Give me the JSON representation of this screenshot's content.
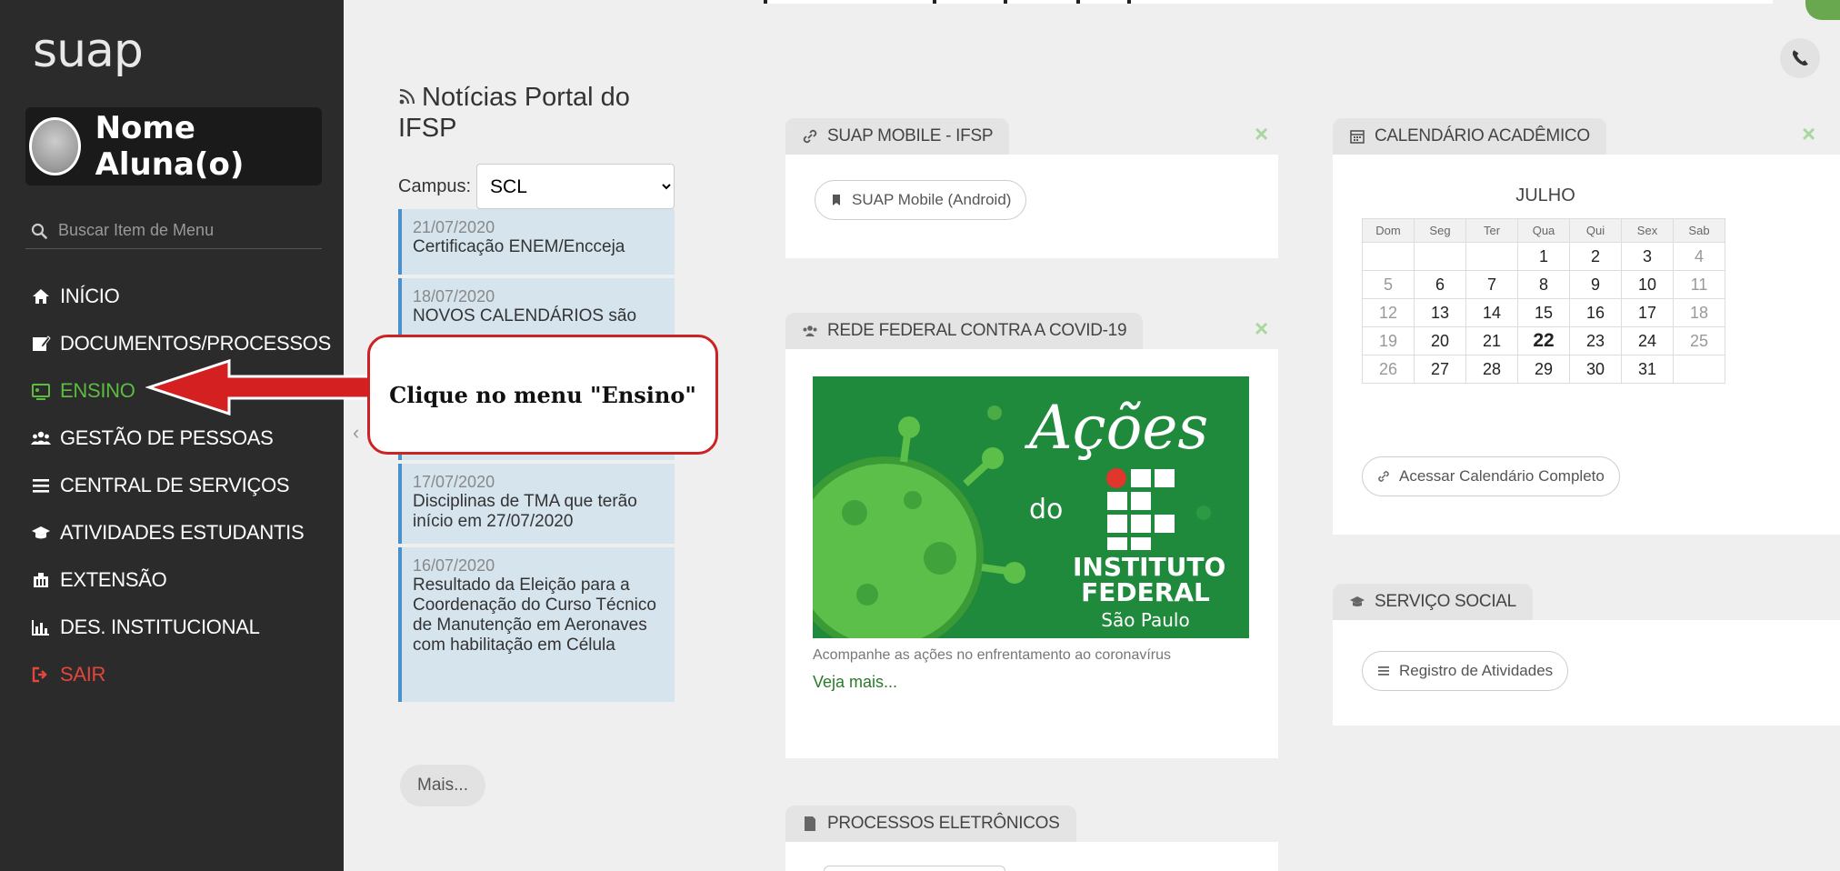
{
  "sidebar": {
    "logo": "suap",
    "user_name": "Nome Aluna(o)",
    "search_placeholder": "Buscar Item de Menu",
    "menu": [
      {
        "label": "INÍCIO",
        "icon": "home-icon"
      },
      {
        "label": "DOCUMENTOS/PROCESSOS",
        "icon": "document-edit-icon"
      },
      {
        "label": "ENSINO",
        "icon": "presentation-board-icon"
      },
      {
        "label": "GESTÃO DE PESSOAS",
        "icon": "users-icon"
      },
      {
        "label": "CENTRAL DE SERVIÇOS",
        "icon": "list-icon"
      },
      {
        "label": "ATIVIDADES ESTUDANTIS",
        "icon": "graduation-cap-icon"
      },
      {
        "label": "EXTENSÃO",
        "icon": "building-icon"
      },
      {
        "label": "DES. INSTITUCIONAL",
        "icon": "bar-chart-icon"
      },
      {
        "label": "SAIR",
        "icon": "sign-out-icon"
      }
    ],
    "active_color": "#5dbb42",
    "logout_color": "#e2463c"
  },
  "news": {
    "title": "Notícias Portal do IFSP",
    "campus_label": "Campus:",
    "campus_value": "SCL",
    "items": [
      {
        "date": "21/07/2020",
        "text": "Certificação ENEM/Encceja"
      },
      {
        "date": "18/07/2020",
        "text": "NOVOS CALENDÁRIOS são"
      },
      {
        "date": "17/07/2020",
        "text": "Disciplinas de TMA que terão início em 27/07/2020"
      },
      {
        "date": "16/07/2020",
        "text": "Resultado da Eleição para a Coordenação do Curso Técnico de Manutenção em Aeronaves com habilitação em Célula"
      }
    ],
    "more_label": "Mais..."
  },
  "annotation": {
    "text": "Clique no menu \"Ensino\""
  },
  "cards": {
    "mobile": {
      "title": "SUAP MOBILE - IFSP",
      "button": "SUAP Mobile (Android)"
    },
    "covid": {
      "title": "REDE FEDERAL CONTRA A COVID-19",
      "banner_script": "Ações",
      "banner_do": "do",
      "banner_inst": "INSTITUTO FEDERAL",
      "banner_sp": "São Paulo",
      "text": "Acompanhe as ações no enfrentamento ao coronavírus",
      "link": "Veja mais..."
    },
    "processos": {
      "title": "PROCESSOS ELETRÔNICOS"
    },
    "calendar": {
      "title": "CALENDÁRIO ACADÊMICO",
      "month": "JULHO",
      "weekdays": [
        "Dom",
        "Seg",
        "Ter",
        "Qua",
        "Qui",
        "Sex",
        "Sab"
      ],
      "weeks": [
        [
          "",
          "",
          "",
          "1",
          "2",
          "3",
          "4"
        ],
        [
          "5",
          "6",
          "7",
          "8",
          "9",
          "10",
          "11"
        ],
        [
          "12",
          "13",
          "14",
          "15",
          "16",
          "17",
          "18"
        ],
        [
          "19",
          "20",
          "21",
          "22",
          "23",
          "24",
          "25"
        ],
        [
          "26",
          "27",
          "28",
          "29",
          "30",
          "31",
          ""
        ]
      ],
      "today": "22",
      "link": "Acessar Calendário Completo"
    },
    "social": {
      "title": "SERVIÇO SOCIAL",
      "button": "Registro de Atividades"
    }
  },
  "close_symbol": "×"
}
